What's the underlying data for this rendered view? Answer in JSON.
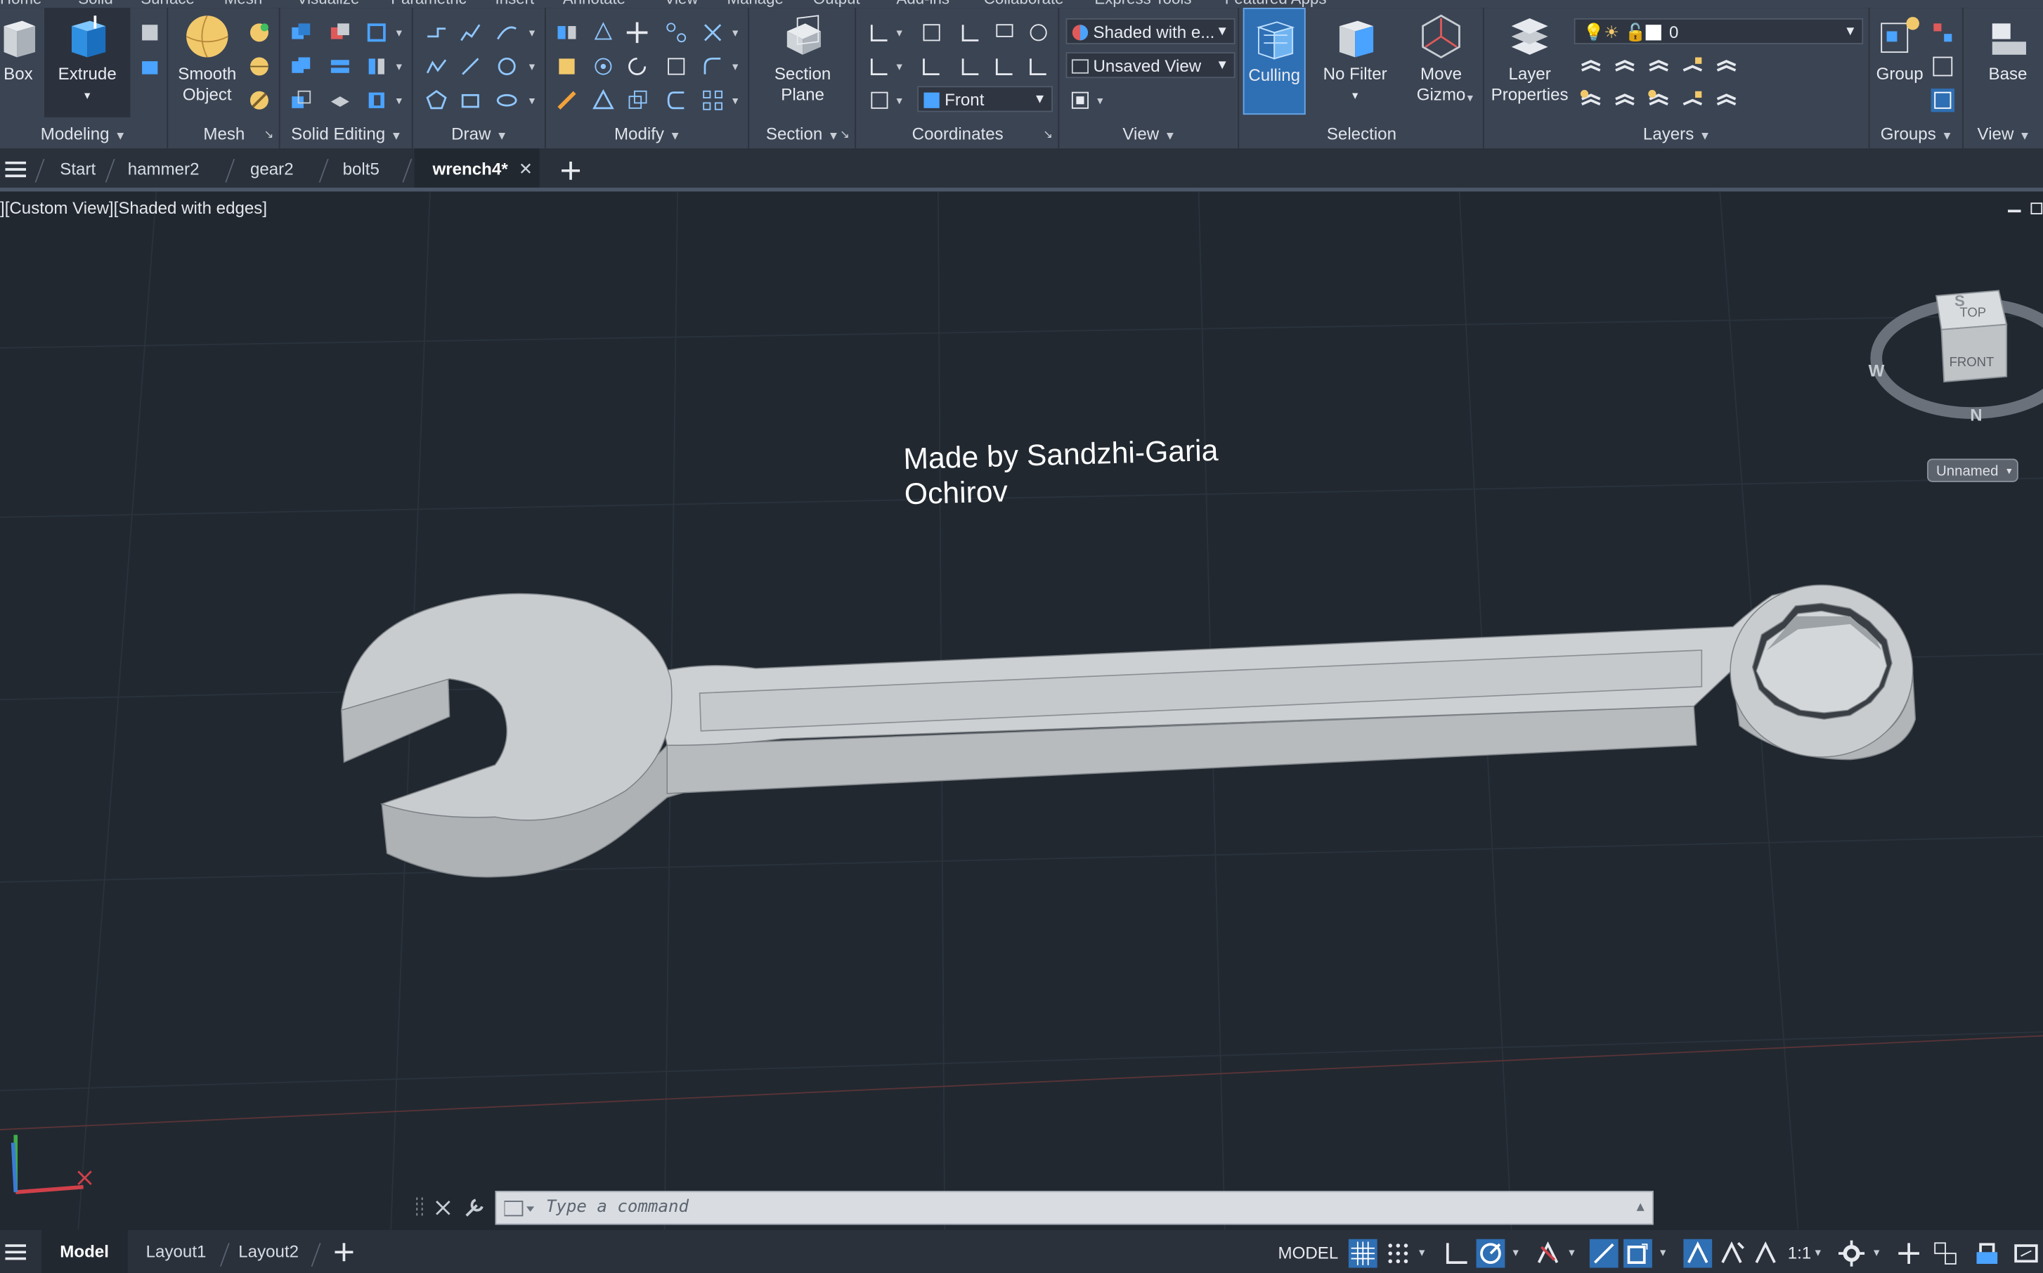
{
  "menu": {
    "items": [
      "Home",
      "Solid",
      "Surface",
      "Mesh",
      "Visualize",
      "Parametric",
      "Insert",
      "Annotate",
      "View",
      "Manage",
      "Output",
      "Add-ins",
      "Collaborate",
      "Express Tools",
      "Featured Apps"
    ]
  },
  "ribbon": {
    "modeling": {
      "title": "Modeling",
      "box_label": "Box",
      "extrude_label": "Extrude"
    },
    "mesh": {
      "title": "Mesh",
      "smooth_object_line1": "Smooth",
      "smooth_object_line2": "Object"
    },
    "solid_editing": {
      "title": "Solid Editing"
    },
    "draw": {
      "title": "Draw"
    },
    "modify": {
      "title": "Modify"
    },
    "section": {
      "title": "Section",
      "section_plane_line1": "Section",
      "section_plane_line2": "Plane"
    },
    "coordinates": {
      "title": "Coordinates",
      "ucs_dropdown": "Front"
    },
    "view": {
      "title": "View",
      "visual_style": "Shaded with e...",
      "named_view": "Unsaved View"
    },
    "selection": {
      "title": "Selection",
      "culling_label": "Culling",
      "no_filter_label": "No Filter",
      "move_gizmo_line1": "Move",
      "move_gizmo_line2": "Gizmo"
    },
    "layers": {
      "title": "Layers",
      "layer_properties_line1": "Layer",
      "layer_properties_line2": "Properties",
      "current_layer": "0"
    },
    "groups": {
      "title": "Groups",
      "group_label": "Group"
    },
    "view2": {
      "title": "View",
      "base_label": "Base"
    }
  },
  "tabs": {
    "items": [
      {
        "label": "Start"
      },
      {
        "label": "hammer2"
      },
      {
        "label": "gear2"
      },
      {
        "label": "bolt5"
      },
      {
        "label": "wrench4*"
      }
    ],
    "active_index": 4
  },
  "viewport": {
    "label": "][Custom View][Shaded with edges]",
    "text_line1": "Made by Sandzhi-Garia",
    "text_line2": "Ochirov",
    "viewcube": {
      "top": "TOP",
      "front": "FRONT",
      "compass_w": "W",
      "compass_n": "N",
      "compass_s": "S"
    },
    "named_view_button": "Unnamed"
  },
  "command": {
    "placeholder": "Type a command"
  },
  "status": {
    "layout_tabs": [
      "Model",
      "Layout1",
      "Layout2"
    ],
    "model_space": "MODEL",
    "scale": "1:1"
  },
  "colors": {
    "ribbon_bg": "#3b4453",
    "viewport_bg": "#212830",
    "accent_blue": "#2f6fb4",
    "wrench_gray": "#c4c7c9"
  }
}
